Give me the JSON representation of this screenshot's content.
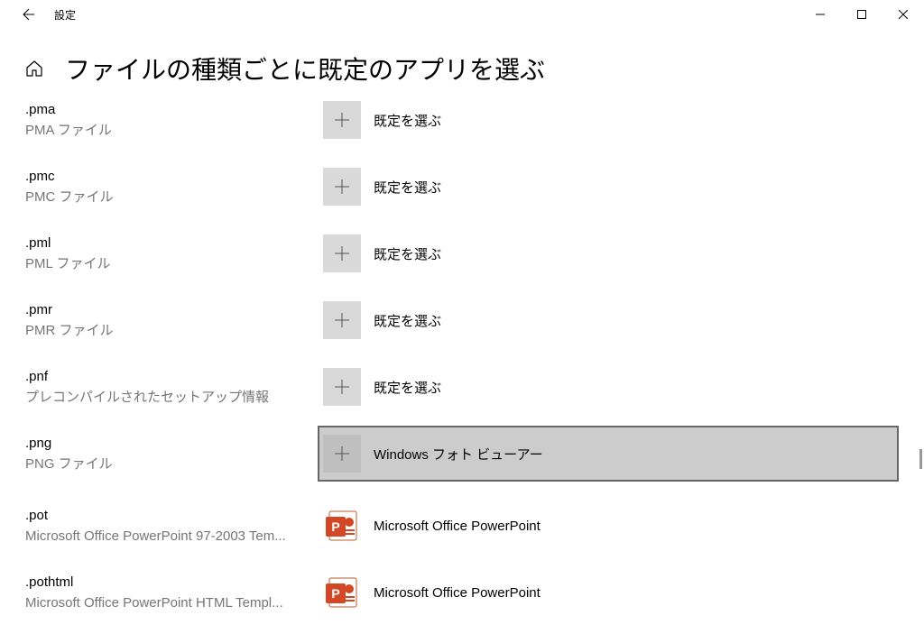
{
  "window": {
    "title": "設定"
  },
  "page": {
    "title": "ファイルの種類ごとに既定のアプリを選ぶ"
  },
  "choose_default_label": "既定を選ぶ",
  "files": [
    {
      "ext": ".pma",
      "desc": "PMA ファイル",
      "app": null
    },
    {
      "ext": ".pmc",
      "desc": "PMC ファイル",
      "app": null
    },
    {
      "ext": ".pml",
      "desc": "PML ファイル",
      "app": null
    },
    {
      "ext": ".pmr",
      "desc": "PMR ファイル",
      "app": null
    },
    {
      "ext": ".pnf",
      "desc": "プレコンパイルされたセットアップ情報",
      "app": null
    },
    {
      "ext": ".png",
      "desc": "PNG ファイル",
      "app": "Windows フォト ビューアー",
      "selected": true,
      "icon": "plus"
    },
    {
      "ext": ".pot",
      "desc": "Microsoft Office PowerPoint 97-2003 Tem...",
      "app": "Microsoft Office PowerPoint",
      "icon": "ppt"
    },
    {
      "ext": ".pothtml",
      "desc": "Microsoft Office PowerPoint HTML Templ...",
      "app": "Microsoft Office PowerPoint",
      "icon": "ppt"
    }
  ]
}
